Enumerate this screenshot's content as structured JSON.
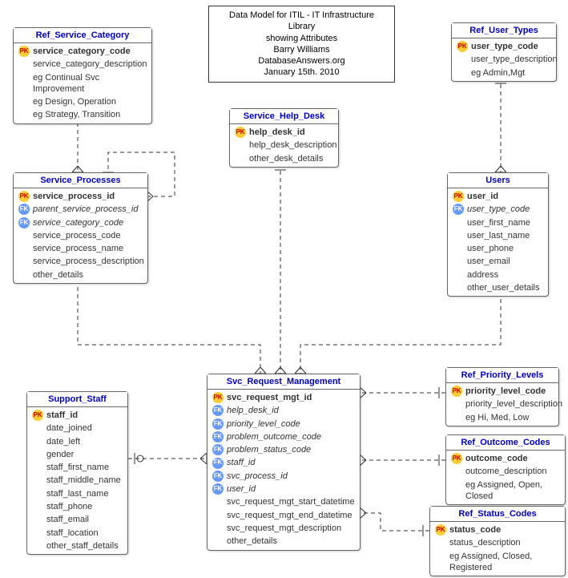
{
  "title_box": {
    "line1": "Data Model for ITIL - IT Infrastructure Library",
    "line2": "showing Attributes",
    "line3": "Barry Williams",
    "line4": "DatabaseAnswers.org",
    "line5": "January 15th. 2010"
  },
  "entities": {
    "ref_service_category": {
      "name": "Ref_Service_Category",
      "attrs": [
        {
          "key": "pk",
          "text": "service_category_code",
          "bold": true
        },
        {
          "key": "",
          "text": "service_category_description"
        },
        {
          "key": "",
          "text": "eg Continual Svc Improvement"
        },
        {
          "key": "",
          "text": "eg Design, Operation"
        },
        {
          "key": "",
          "text": "eg Strategy, Transition"
        }
      ]
    },
    "service_processes": {
      "name": "Service_Processes",
      "attrs": [
        {
          "key": "pk",
          "text": "service_process_id",
          "bold": true
        },
        {
          "key": "fk",
          "text": "parent_service_process_id",
          "italic": true
        },
        {
          "key": "fk",
          "text": "service_category_code",
          "italic": true
        },
        {
          "key": "",
          "text": "service_process_code"
        },
        {
          "key": "",
          "text": "service_process_name"
        },
        {
          "key": "",
          "text": "service_process_description"
        },
        {
          "key": "",
          "text": "other_details"
        }
      ]
    },
    "service_help_desk": {
      "name": "Service_Help_Desk",
      "attrs": [
        {
          "key": "pk",
          "text": "help_desk_id",
          "bold": true
        },
        {
          "key": "",
          "text": "help_desk_description"
        },
        {
          "key": "",
          "text": "other_desk_details"
        }
      ]
    },
    "ref_user_types": {
      "name": "Ref_User_Types",
      "attrs": [
        {
          "key": "pk",
          "text": "user_type_code",
          "bold": true
        },
        {
          "key": "",
          "text": "user_type_description"
        },
        {
          "key": "",
          "text": "eg Admin,Mgt"
        }
      ]
    },
    "users": {
      "name": "Users",
      "attrs": [
        {
          "key": "pk",
          "text": "user_id",
          "bold": true
        },
        {
          "key": "fk",
          "text": "user_type_code",
          "italic": true
        },
        {
          "key": "",
          "text": "user_first_name"
        },
        {
          "key": "",
          "text": "user_last_name"
        },
        {
          "key": "",
          "text": "user_phone"
        },
        {
          "key": "",
          "text": "user_email"
        },
        {
          "key": "",
          "text": "address"
        },
        {
          "key": "",
          "text": "other_user_details"
        }
      ]
    },
    "svc_request_management": {
      "name": "Svc_Request_Management",
      "attrs": [
        {
          "key": "pk",
          "text": "svc_request_mgt_id",
          "bold": true
        },
        {
          "key": "fk",
          "text": "help_desk_id",
          "italic": true
        },
        {
          "key": "fk",
          "text": "priority_level_code",
          "italic": true
        },
        {
          "key": "fk",
          "text": "problem_outcome_code",
          "italic": true
        },
        {
          "key": "fk",
          "text": "problem_status_code",
          "italic": true
        },
        {
          "key": "fk",
          "text": "staff_id",
          "italic": true
        },
        {
          "key": "fk",
          "text": "svc_process_id",
          "italic": true
        },
        {
          "key": "fk",
          "text": "user_id",
          "italic": true
        },
        {
          "key": "",
          "text": "svc_request_mgt_start_datetime"
        },
        {
          "key": "",
          "text": "svc_request_mgt_end_datetime"
        },
        {
          "key": "",
          "text": "svc_request_mgt_description"
        },
        {
          "key": "",
          "text": "other_details"
        }
      ]
    },
    "support_staff": {
      "name": "Support_Staff",
      "attrs": [
        {
          "key": "pk",
          "text": "staff_id",
          "bold": true
        },
        {
          "key": "",
          "text": "date_joined"
        },
        {
          "key": "",
          "text": "date_left"
        },
        {
          "key": "",
          "text": "gender"
        },
        {
          "key": "",
          "text": "staff_first_name"
        },
        {
          "key": "",
          "text": "staff_middle_name"
        },
        {
          "key": "",
          "text": "staff_last_name"
        },
        {
          "key": "",
          "text": "staff_phone"
        },
        {
          "key": "",
          "text": "staff_email"
        },
        {
          "key": "",
          "text": "staff_location"
        },
        {
          "key": "",
          "text": "other_staff_details"
        }
      ]
    },
    "ref_priority_levels": {
      "name": "Ref_Priority_Levels",
      "attrs": [
        {
          "key": "pk",
          "text": "priority_level_code",
          "bold": true
        },
        {
          "key": "",
          "text": "priority_level_description"
        },
        {
          "key": "",
          "text": "eg Hi, Med, Low"
        }
      ]
    },
    "ref_outcome_codes": {
      "name": "Ref_Outcome_Codes",
      "attrs": [
        {
          "key": "pk",
          "text": "outcome_code",
          "bold": true
        },
        {
          "key": "",
          "text": "outcome_description"
        },
        {
          "key": "",
          "text": "eg Assigned, Open, Closed"
        }
      ]
    },
    "ref_status_codes": {
      "name": "Ref_Status_Codes",
      "attrs": [
        {
          "key": "pk",
          "text": "status_code",
          "bold": true
        },
        {
          "key": "",
          "text": "status_description"
        },
        {
          "key": "",
          "text": "eg Assigned, Closed, Registered"
        }
      ]
    }
  }
}
